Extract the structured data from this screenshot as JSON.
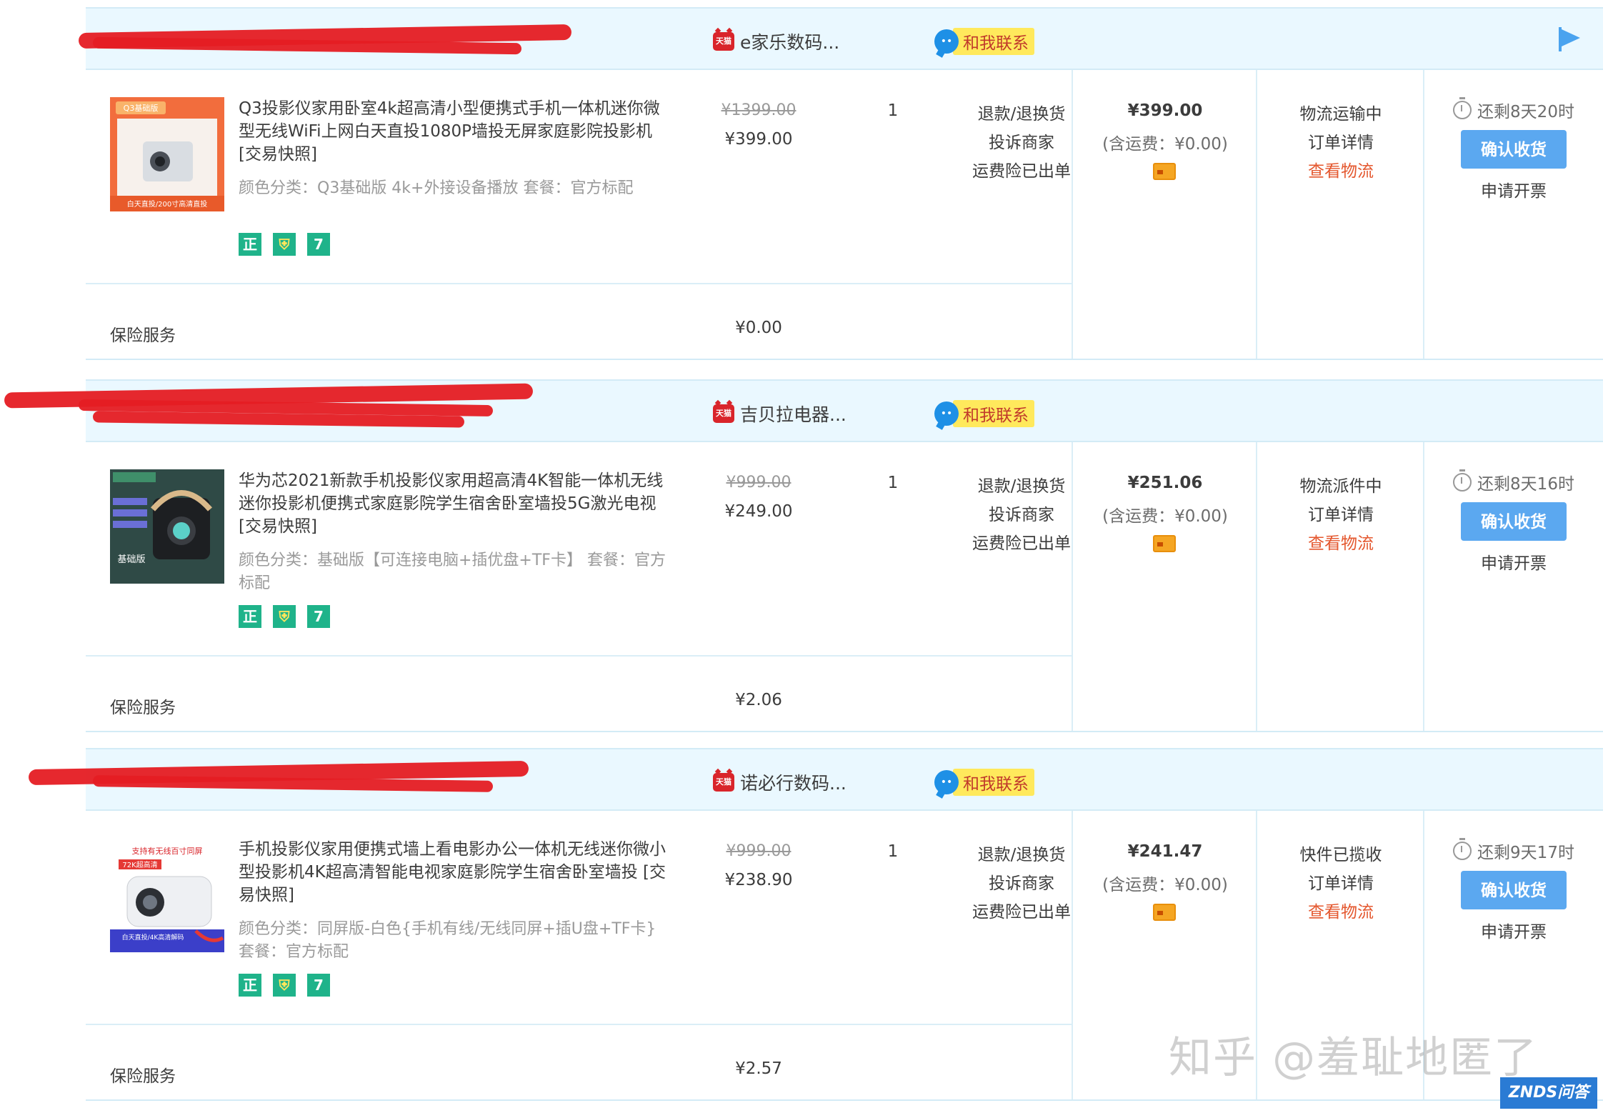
{
  "orders": [
    {
      "shop_name": "e家乐数码...",
      "contact_label": "和我联系",
      "product_title": "Q3投影仪家用卧室4k超高清小型便携式手机一体机迷你微型无线WiFi上网白天直投1080P墙投无屏家庭影院投影机 [交易快照]",
      "sku": "颜色分类：Q3基础版 4k+外接设备播放  套餐：官方标配",
      "orig_price": "¥1399.00",
      "unit_price": "¥399.00",
      "qty": "1",
      "actions": [
        "退款/退换货",
        "投诉商家",
        "运费险已出单"
      ],
      "total": "¥399.00",
      "shipping": "(含运费：¥0.00)",
      "status": "物流运输中",
      "detail": "订单详情",
      "track": "查看物流",
      "remain": "还剩8天20时",
      "confirm": "确认收货",
      "invoice": "申请开票",
      "insurance_label": "保险服务",
      "insurance_price": "¥0.00",
      "thumb_text": [
        "Q3基础版",
        "白天直投/200寸高清直投"
      ]
    },
    {
      "shop_name": "吉贝拉电器...",
      "contact_label": "和我联系",
      "product_title": "华为芯2021新款手机投影仪家用超高清4K智能一体机无线迷你投影机便携式家庭影院学生宿舍卧室墙投5G激光电视 [交易快照]",
      "sku": "颜色分类：基础版【可连接电脑+插优盘+TF卡】  套餐：官方标配",
      "orig_price": "¥999.00",
      "unit_price": "¥249.00",
      "qty": "1",
      "actions": [
        "退款/退换货",
        "投诉商家",
        "运费险已出单"
      ],
      "total": "¥251.06",
      "shipping": "(含运费：¥0.00)",
      "status": "物流派件中",
      "detail": "订单详情",
      "track": "查看物流",
      "remain": "还剩8天16时",
      "confirm": "确认收货",
      "invoice": "申请开票",
      "insurance_label": "保险服务",
      "insurance_price": "¥2.06",
      "thumb_text": [
        "基础版"
      ]
    },
    {
      "shop_name": "诺必行数码...",
      "contact_label": "和我联系",
      "product_title": "手机投影仪家用便携式墙上看电影办公一体机无线迷你微小型投影机4K超高清智能电视家庭影院学生宿舍卧室墙投 [交易快照]",
      "sku": "颜色分类：同屏版-白色{手机有线/无线同屏+插U盘+TF卡}  套餐：官方标配",
      "orig_price": "¥999.00",
      "unit_price": "¥238.90",
      "qty": "1",
      "actions": [
        "退款/退换货",
        "投诉商家",
        "运费险已出单"
      ],
      "total": "¥241.47",
      "shipping": "(含运费：¥0.00)",
      "status": "快件已揽收",
      "detail": "订单详情",
      "track": "查看物流",
      "remain": "还剩9天17时",
      "confirm": "确认收货",
      "invoice": "申请开票",
      "insurance_label": "保险服务",
      "insurance_price": "¥2.57",
      "thumb_text": [
        "支持有无线百寸同屏",
        "72K超高清",
        "白天直投/4K高清解码"
      ]
    }
  ],
  "badges": [
    "正",
    "盾",
    "7"
  ],
  "tmall_icon_text": "天猫",
  "watermark": "知乎 @羞耻地匿了",
  "znds_logo": "ZNDS问答",
  "colors": {
    "header_bg": "#eaf8ff",
    "confirm_btn": "#5ba8f0",
    "track_link": "#e4572e",
    "contact_bg": "#ffe95c"
  }
}
